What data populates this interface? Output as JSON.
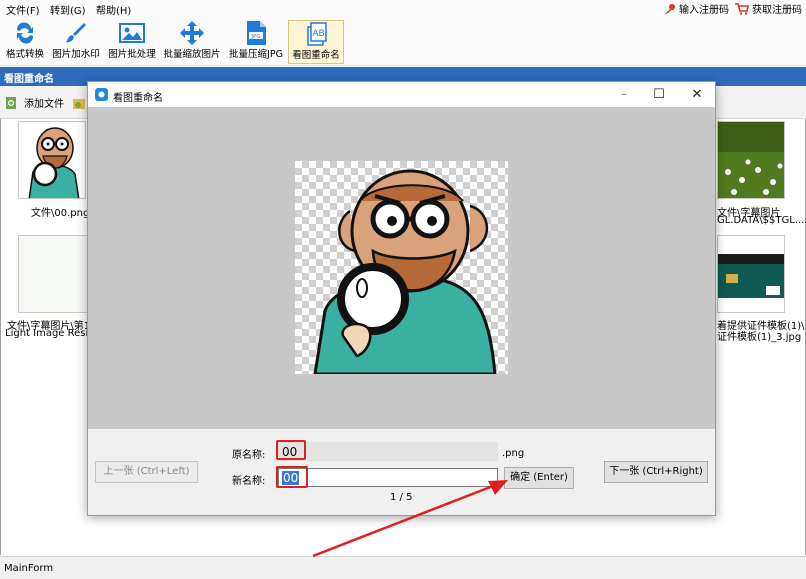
{
  "menubar": {
    "items": [
      "文件(F)",
      "转到(G)",
      "帮助(H)"
    ],
    "register_label": "输入注册码",
    "get_code_label": "获取注册码"
  },
  "toolbar": {
    "tools": [
      "格式转换",
      "图片加水印",
      "图片批处理",
      "批量缩放图片",
      "批量压缩JPG",
      "看图重命名"
    ],
    "active_tool": "看图重命名"
  },
  "main": {
    "section_title": "看图重命名",
    "add_file_label": "添加文件",
    "thumbnails": [
      {
        "caption": "文件\\00.png"
      },
      {
        "caption_line1": "文件\\字幕图片",
        "caption_line2": "GL.DATA\\$$TGL...."
      },
      {
        "caption_line1": "文件\\字幕图片\\第1",
        "caption_line2": "Light Image Resize"
      },
      {
        "caption_line1": "着提供证件模板(1)\\",
        "caption_line2": "证件模板(1)_3.jpg"
      }
    ]
  },
  "status": {
    "text": "MainForm"
  },
  "dialog": {
    "title": "看图重命名",
    "original_name_label": "原名称:",
    "original_name_value": "00",
    "extension": ".png",
    "new_name_label": "新名称:",
    "new_name_value": "00",
    "confirm_button": "确定 (Enter)",
    "prev_button": "上一张 (Ctrl+Left)",
    "next_button": "下一张 (Ctrl+Right)",
    "counter": "1 / 5"
  },
  "colors": {
    "accent": "#2e6bbd",
    "annotation": "#e02020"
  }
}
